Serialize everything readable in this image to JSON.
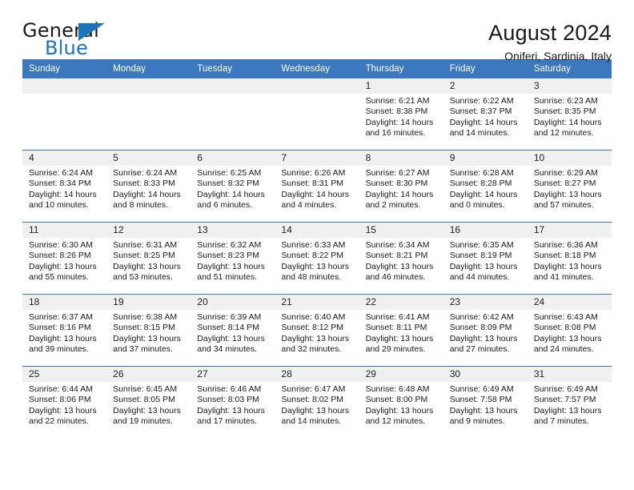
{
  "brand": {
    "word1": "General",
    "word2": "Blue",
    "logo_icon": "triangle-logo-icon",
    "accent_color": "#1b75bb"
  },
  "header": {
    "title": "August 2024",
    "subtitle": "Oniferi, Sardinia, Italy"
  },
  "calendar": {
    "header_color": "#3b78bd",
    "daynum_bg": "#f0f0f0",
    "weekday_headers": [
      "Sunday",
      "Monday",
      "Tuesday",
      "Wednesday",
      "Thursday",
      "Friday",
      "Saturday"
    ],
    "weeks": [
      [
        {
          "day": "",
          "empty": true
        },
        {
          "day": "",
          "empty": true
        },
        {
          "day": "",
          "empty": true
        },
        {
          "day": "",
          "empty": true
        },
        {
          "day": "1",
          "sunrise": "Sunrise: 6:21 AM",
          "sunset": "Sunset: 8:38 PM",
          "daylight": "Daylight: 14 hours and 16 minutes."
        },
        {
          "day": "2",
          "sunrise": "Sunrise: 6:22 AM",
          "sunset": "Sunset: 8:37 PM",
          "daylight": "Daylight: 14 hours and 14 minutes."
        },
        {
          "day": "3",
          "sunrise": "Sunrise: 6:23 AM",
          "sunset": "Sunset: 8:35 PM",
          "daylight": "Daylight: 14 hours and 12 minutes."
        }
      ],
      [
        {
          "day": "4",
          "sunrise": "Sunrise: 6:24 AM",
          "sunset": "Sunset: 8:34 PM",
          "daylight": "Daylight: 14 hours and 10 minutes."
        },
        {
          "day": "5",
          "sunrise": "Sunrise: 6:24 AM",
          "sunset": "Sunset: 8:33 PM",
          "daylight": "Daylight: 14 hours and 8 minutes."
        },
        {
          "day": "6",
          "sunrise": "Sunrise: 6:25 AM",
          "sunset": "Sunset: 8:32 PM",
          "daylight": "Daylight: 14 hours and 6 minutes."
        },
        {
          "day": "7",
          "sunrise": "Sunrise: 6:26 AM",
          "sunset": "Sunset: 8:31 PM",
          "daylight": "Daylight: 14 hours and 4 minutes."
        },
        {
          "day": "8",
          "sunrise": "Sunrise: 6:27 AM",
          "sunset": "Sunset: 8:30 PM",
          "daylight": "Daylight: 14 hours and 2 minutes."
        },
        {
          "day": "9",
          "sunrise": "Sunrise: 6:28 AM",
          "sunset": "Sunset: 8:28 PM",
          "daylight": "Daylight: 14 hours and 0 minutes."
        },
        {
          "day": "10",
          "sunrise": "Sunrise: 6:29 AM",
          "sunset": "Sunset: 8:27 PM",
          "daylight": "Daylight: 13 hours and 57 minutes."
        }
      ],
      [
        {
          "day": "11",
          "sunrise": "Sunrise: 6:30 AM",
          "sunset": "Sunset: 8:26 PM",
          "daylight": "Daylight: 13 hours and 55 minutes."
        },
        {
          "day": "12",
          "sunrise": "Sunrise: 6:31 AM",
          "sunset": "Sunset: 8:25 PM",
          "daylight": "Daylight: 13 hours and 53 minutes."
        },
        {
          "day": "13",
          "sunrise": "Sunrise: 6:32 AM",
          "sunset": "Sunset: 8:23 PM",
          "daylight": "Daylight: 13 hours and 51 minutes."
        },
        {
          "day": "14",
          "sunrise": "Sunrise: 6:33 AM",
          "sunset": "Sunset: 8:22 PM",
          "daylight": "Daylight: 13 hours and 48 minutes."
        },
        {
          "day": "15",
          "sunrise": "Sunrise: 6:34 AM",
          "sunset": "Sunset: 8:21 PM",
          "daylight": "Daylight: 13 hours and 46 minutes."
        },
        {
          "day": "16",
          "sunrise": "Sunrise: 6:35 AM",
          "sunset": "Sunset: 8:19 PM",
          "daylight": "Daylight: 13 hours and 44 minutes."
        },
        {
          "day": "17",
          "sunrise": "Sunrise: 6:36 AM",
          "sunset": "Sunset: 8:18 PM",
          "daylight": "Daylight: 13 hours and 41 minutes."
        }
      ],
      [
        {
          "day": "18",
          "sunrise": "Sunrise: 6:37 AM",
          "sunset": "Sunset: 8:16 PM",
          "daylight": "Daylight: 13 hours and 39 minutes."
        },
        {
          "day": "19",
          "sunrise": "Sunrise: 6:38 AM",
          "sunset": "Sunset: 8:15 PM",
          "daylight": "Daylight: 13 hours and 37 minutes."
        },
        {
          "day": "20",
          "sunrise": "Sunrise: 6:39 AM",
          "sunset": "Sunset: 8:14 PM",
          "daylight": "Daylight: 13 hours and 34 minutes."
        },
        {
          "day": "21",
          "sunrise": "Sunrise: 6:40 AM",
          "sunset": "Sunset: 8:12 PM",
          "daylight": "Daylight: 13 hours and 32 minutes."
        },
        {
          "day": "22",
          "sunrise": "Sunrise: 6:41 AM",
          "sunset": "Sunset: 8:11 PM",
          "daylight": "Daylight: 13 hours and 29 minutes."
        },
        {
          "day": "23",
          "sunrise": "Sunrise: 6:42 AM",
          "sunset": "Sunset: 8:09 PM",
          "daylight": "Daylight: 13 hours and 27 minutes."
        },
        {
          "day": "24",
          "sunrise": "Sunrise: 6:43 AM",
          "sunset": "Sunset: 8:08 PM",
          "daylight": "Daylight: 13 hours and 24 minutes."
        }
      ],
      [
        {
          "day": "25",
          "sunrise": "Sunrise: 6:44 AM",
          "sunset": "Sunset: 8:06 PM",
          "daylight": "Daylight: 13 hours and 22 minutes."
        },
        {
          "day": "26",
          "sunrise": "Sunrise: 6:45 AM",
          "sunset": "Sunset: 8:05 PM",
          "daylight": "Daylight: 13 hours and 19 minutes."
        },
        {
          "day": "27",
          "sunrise": "Sunrise: 6:46 AM",
          "sunset": "Sunset: 8:03 PM",
          "daylight": "Daylight: 13 hours and 17 minutes."
        },
        {
          "day": "28",
          "sunrise": "Sunrise: 6:47 AM",
          "sunset": "Sunset: 8:02 PM",
          "daylight": "Daylight: 13 hours and 14 minutes."
        },
        {
          "day": "29",
          "sunrise": "Sunrise: 6:48 AM",
          "sunset": "Sunset: 8:00 PM",
          "daylight": "Daylight: 13 hours and 12 minutes."
        },
        {
          "day": "30",
          "sunrise": "Sunrise: 6:49 AM",
          "sunset": "Sunset: 7:58 PM",
          "daylight": "Daylight: 13 hours and 9 minutes."
        },
        {
          "day": "31",
          "sunrise": "Sunrise: 6:49 AM",
          "sunset": "Sunset: 7:57 PM",
          "daylight": "Daylight: 13 hours and 7 minutes."
        }
      ]
    ]
  }
}
